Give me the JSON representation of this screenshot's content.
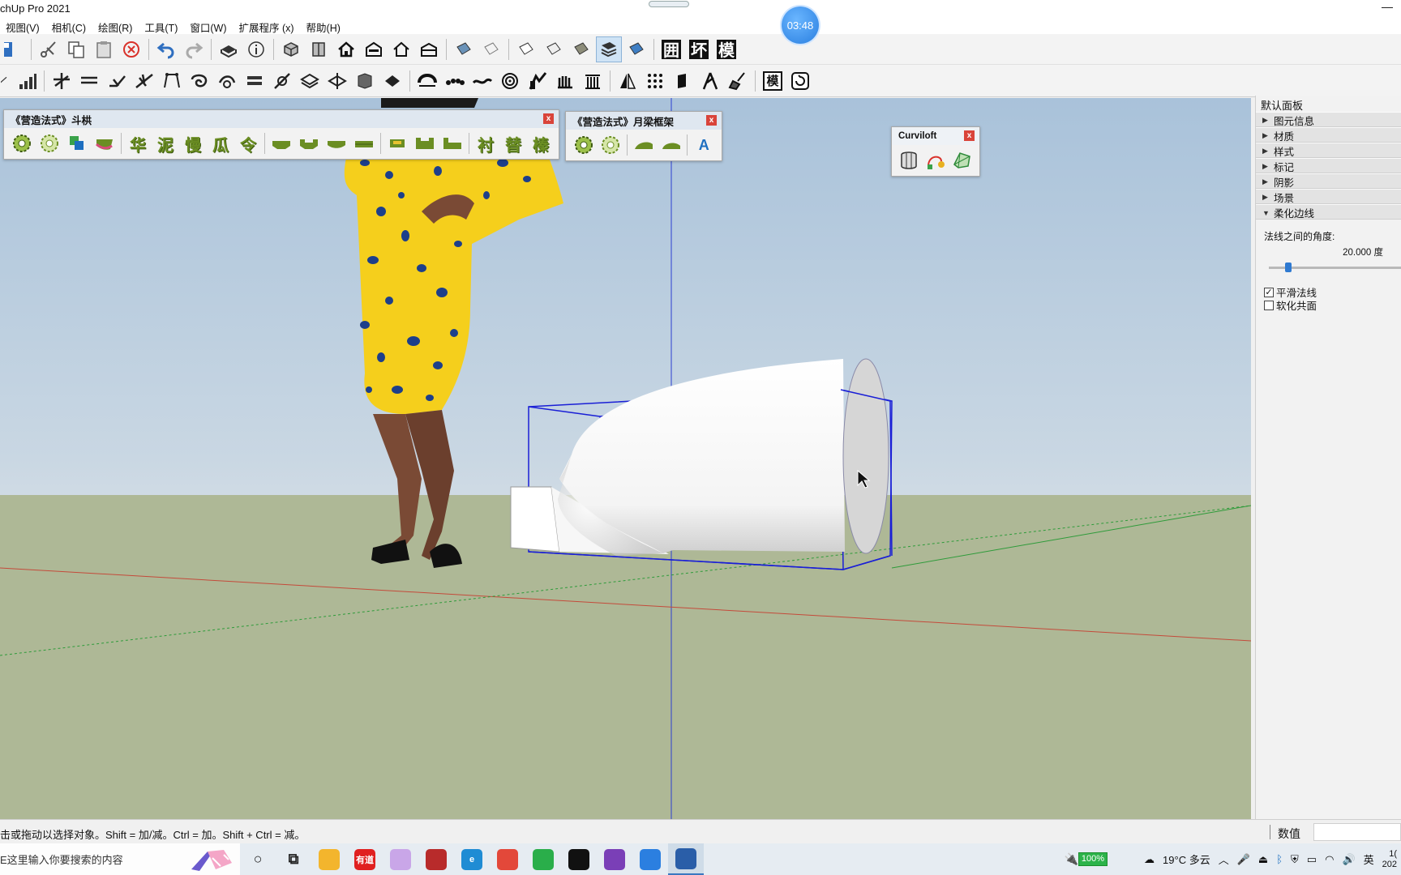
{
  "window": {
    "title": "chUp Pro 2021"
  },
  "timer": "03:48",
  "menu": [
    "视图(V)",
    "相机(C)",
    "绘图(R)",
    "工具(T)",
    "窗口(W)",
    "扩展程序 (x)",
    "帮助(H)"
  ],
  "toolbar1_glyphs": [
    "囲",
    "坏",
    "模"
  ],
  "float_dougong": {
    "title": "《营造法式》斗栱",
    "chars": [
      "华",
      "泥",
      "慢",
      "瓜",
      "令",
      "衬",
      "替",
      "榛"
    ]
  },
  "float_yueliang": {
    "title": "《营造法式》月梁框架",
    "text_btn": "A"
  },
  "float_curviloft": {
    "title": "Curviloft"
  },
  "close_glyph": "x",
  "toolbar2_glyphs": [
    "模"
  ],
  "tray": {
    "title": "默认面板",
    "sections": [
      {
        "label": "图元信息",
        "expanded": false
      },
      {
        "label": "材质",
        "expanded": false
      },
      {
        "label": "样式",
        "expanded": false
      },
      {
        "label": "标记",
        "expanded": false
      },
      {
        "label": "阴影",
        "expanded": false
      },
      {
        "label": "场景",
        "expanded": false
      },
      {
        "label": "柔化边线",
        "expanded": true
      }
    ],
    "soften": {
      "angle_label": "法线之间的角度:",
      "angle_value": "20.000 度",
      "slider_fraction": 0.12,
      "smooth_normals_label": "平滑法线",
      "smooth_normals_checked": true,
      "soften_coplanar_label": "软化共面",
      "soften_coplanar_checked": false
    }
  },
  "status": {
    "text": "击或拖动以选择对象。Shift = 加/减。Ctrl = 加。Shift + Ctrl = 减。",
    "measure_label": "数值"
  },
  "taskbar": {
    "search_placeholder": "E这里输入你要搜索的内容",
    "apps": [
      {
        "name": "cortana",
        "color": "#222222",
        "glyph": "○"
      },
      {
        "name": "task-view",
        "color": "#222222",
        "glyph": "⧉"
      },
      {
        "name": "file-explorer",
        "color": "#f3b52d",
        "glyph": ""
      },
      {
        "name": "youdao",
        "color": "#e02020",
        "glyph": "有道"
      },
      {
        "name": "app-pink",
        "color": "#c9a6e8",
        "glyph": ""
      },
      {
        "name": "app-red",
        "color": "#b82b2b",
        "glyph": ""
      },
      {
        "name": "edge",
        "color": "#1f8cd4",
        "glyph": "e"
      },
      {
        "name": "chrome",
        "color": "#e3483a",
        "glyph": ""
      },
      {
        "name": "wechat",
        "color": "#2aae4a",
        "glyph": ""
      },
      {
        "name": "qq",
        "color": "#111111",
        "glyph": ""
      },
      {
        "name": "visual-studio",
        "color": "#7a3fb7",
        "glyph": ""
      },
      {
        "name": "feishu",
        "color": "#2b7fe0",
        "glyph": ""
      },
      {
        "name": "sketchup",
        "color": "#2a5ea8",
        "glyph": ""
      }
    ],
    "battery": "100%",
    "weather": "19°C 多云",
    "ime": "英",
    "clock": "1(",
    "date": "202"
  }
}
